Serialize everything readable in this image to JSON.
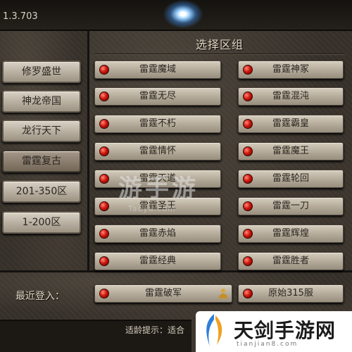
{
  "version": "1.3.703",
  "panel_title": "选择区组",
  "categories": [
    {
      "label": "修罗盛世",
      "active": false
    },
    {
      "label": "神龙帝国",
      "active": false
    },
    {
      "label": "龙行天下",
      "active": false
    },
    {
      "label": "雷霆复古",
      "active": true
    },
    {
      "label": "201-350区",
      "active": false
    },
    {
      "label": "1-200区",
      "active": false
    }
  ],
  "servers": [
    "雷霆魔域",
    "雷霆神冢",
    "雷霆无尽",
    "雷霆混沌",
    "雷霆不朽",
    "雷霆霸皇",
    "雷霆情怀",
    "雷霆魔王",
    "雷霆天道",
    "雷霆轮回",
    "雷霆圣王",
    "雷霆一刀",
    "雷霆赤焰",
    "雷霆辉煌",
    "雷霆经典",
    "雷霆胜者"
  ],
  "recent": {
    "label": "最近登入：",
    "servers": [
      "雷霆破军",
      "原始315服"
    ]
  },
  "footer": {
    "text": "适龄提示：适合"
  },
  "watermark": {
    "center": "游手游",
    "center_sub": "Taoyu.com",
    "logo": "天剑手游网",
    "logo_sub": "tianjian8.com"
  },
  "colors": {
    "status_dot": "#d1160c",
    "button_face": "#b7ae9f",
    "text_light": "#e0d6c2"
  }
}
